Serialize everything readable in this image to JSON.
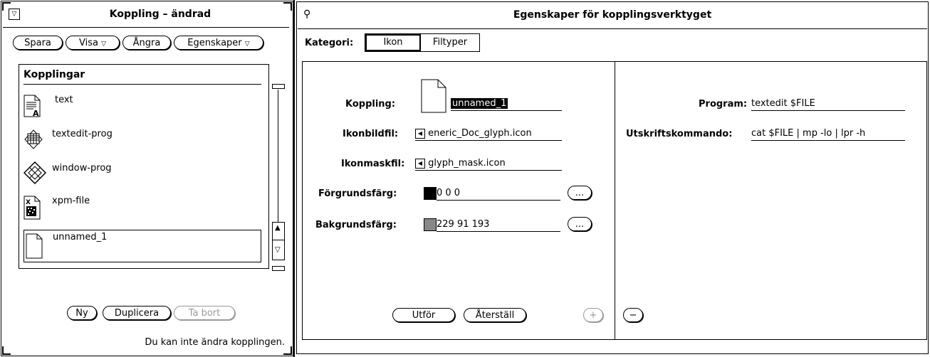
{
  "left_window": {
    "title": "Koppling – ändrad",
    "menu_button_icon": "window-menu-icon",
    "menubar": {
      "spara": "Spara",
      "visa": "Visa",
      "angra": "Ångra",
      "egenskaper": "Egenskaper"
    },
    "list": {
      "header": "Kopplingar",
      "items": [
        {
          "label": "text",
          "icon": "text-document-icon"
        },
        {
          "label": "textedit-prog",
          "icon": "textedit-app-icon"
        },
        {
          "label": "window-prog",
          "icon": "window-prog-icon"
        },
        {
          "label": "xpm-file",
          "icon": "xpm-file-icon"
        },
        {
          "label": "unnamed_1",
          "icon": "generic-document-icon",
          "selected": true
        }
      ]
    },
    "buttons": {
      "ny": "Ny",
      "duplicera": "Duplicera",
      "ta_bort": "Ta bort"
    },
    "status": "Du kan inte ändra kopplingen."
  },
  "right_window": {
    "title": "Egenskaper för kopplingsverktyget",
    "pin_icon": "pushpin-icon",
    "category": {
      "label": "Kategori:",
      "options": [
        "Ikon",
        "Filtyper"
      ],
      "selected": "Ikon"
    },
    "left_pane": {
      "koppling_label": "Koppling:",
      "koppling_value": "unnamed_1",
      "ikonbildfil_label": "Ikonbildfil:",
      "ikonbildfil_value": "eneric_Doc_glyph.icon",
      "ikonmaskfil_label": "Ikonmaskfil:",
      "ikonmaskfil_value": "glyph_mask.icon",
      "forgrund_label": "Förgrundsfärg:",
      "forgrund_value": "0 0 0",
      "forgrund_color": "#000000",
      "bakgrund_label": "Bakgrundsfärg:",
      "bakgrund_value": "229 91 193",
      "bakgrund_color": "#888888",
      "ellipsis": "...",
      "utfor": "Utför",
      "aterstall": "Återställ",
      "plus": "+"
    },
    "right_pane": {
      "program_label": "Program:",
      "program_value": "textedit $FILE",
      "utskrift_label": "Utskriftskommando:",
      "utskrift_value": "cat $FILE | mp -lo | lpr -h",
      "minus": "−"
    }
  }
}
